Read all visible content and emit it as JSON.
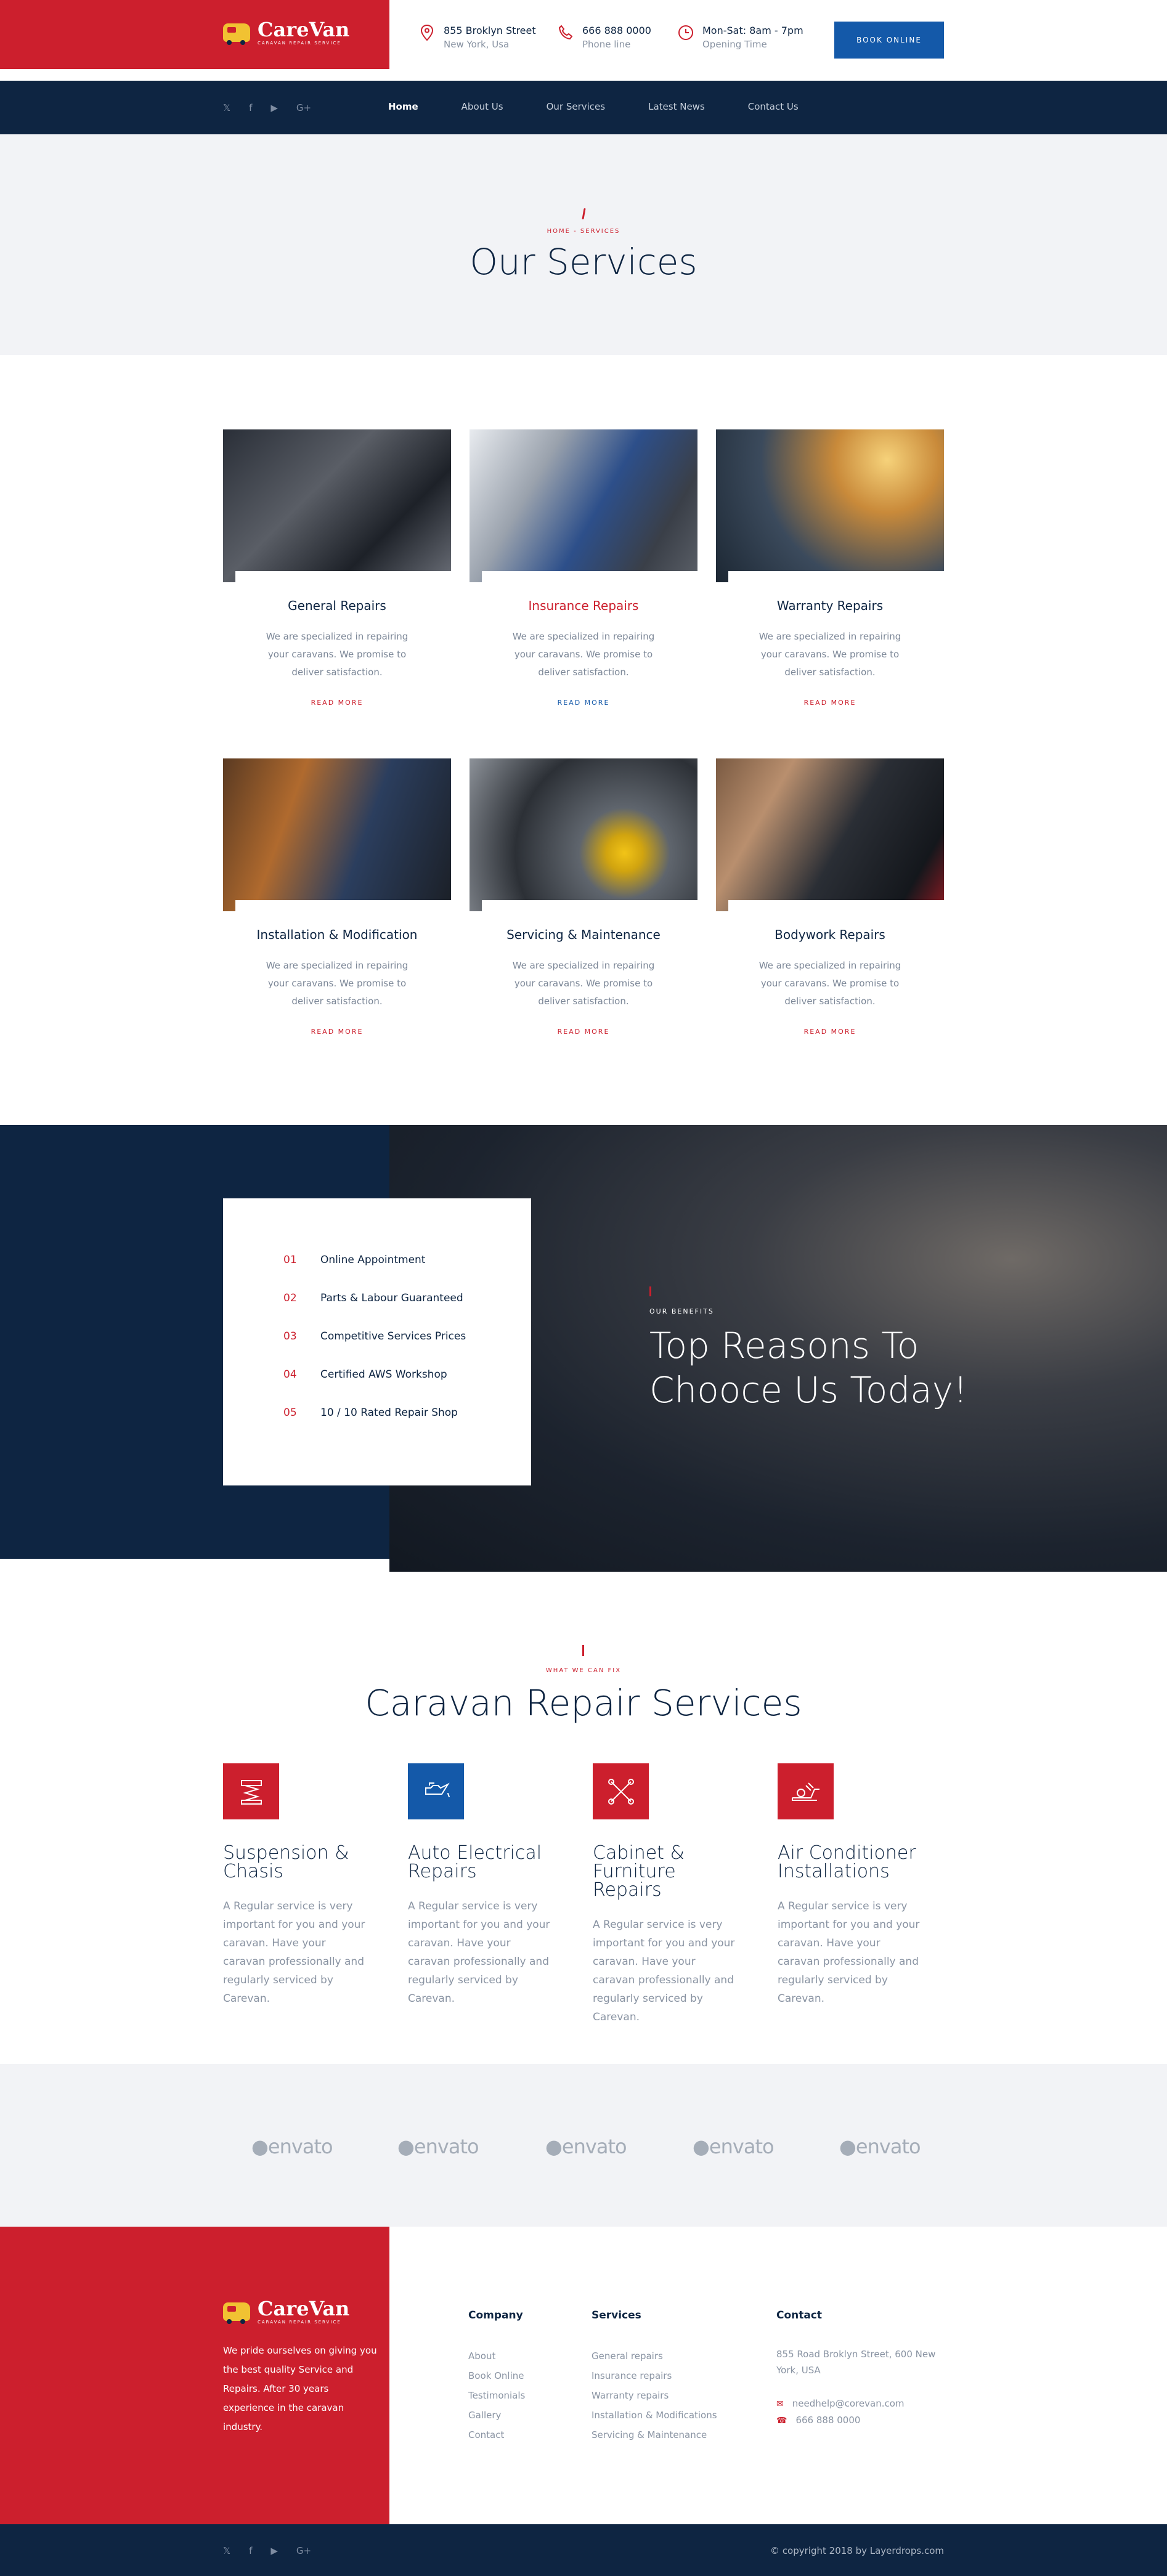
{
  "header": {
    "brand": "CareVan",
    "brand_tagline": "CARAVAN REPAIR SERVICE",
    "address": {
      "line1": "855 Broklyn Street",
      "line2": "New York, Usa"
    },
    "phone": {
      "line1": "666 888 0000",
      "line2": "Phone line"
    },
    "hours": {
      "line1": "Mon-Sat: 8am - 7pm",
      "line2": "Opening Time"
    },
    "book_button": "BOOK ONLINE"
  },
  "nav": {
    "social": [
      "twitter-icon",
      "facebook-icon",
      "youtube-icon",
      "google-plus-icon"
    ],
    "items": [
      {
        "label": "Home",
        "active": true
      },
      {
        "label": "About Us"
      },
      {
        "label": "Our Services"
      },
      {
        "label": "Latest News"
      },
      {
        "label": "Contact Us"
      }
    ]
  },
  "page_header": {
    "breadcrumb": "HOME  -  SERVICES",
    "title": "Our Services"
  },
  "services": [
    {
      "name": "General Repairs",
      "desc": "We are specialized in repairing your caravans. We promise to deliver satisfaction.",
      "more": "READ MORE"
    },
    {
      "name": "Insurance Repairs",
      "desc": "We are specialized in repairing your caravans. We promise to deliver satisfaction.",
      "more": "READ MORE"
    },
    {
      "name": "Warranty Repairs",
      "desc": "We are specialized in repairing your caravans. We promise to deliver satisfaction.",
      "more": "READ MORE"
    },
    {
      "name": "Installation & Modification",
      "desc": "We are specialized in repairing your caravans. We promise to deliver satisfaction.",
      "more": "READ MORE"
    },
    {
      "name": "Servicing & Maintenance",
      "desc": "We are specialized in repairing your caravans. We promise to deliver satisfaction.",
      "more": "READ MORE"
    },
    {
      "name": "Bodywork Repairs",
      "desc": "We are specialized in repairing your caravans. We promise to deliver satisfaction.",
      "more": "READ MORE"
    }
  ],
  "reasons": {
    "items": [
      {
        "num": "01",
        "label": "Online Appointment"
      },
      {
        "num": "02",
        "label": "Parts & Labour Guaranteed"
      },
      {
        "num": "03",
        "label": "Competitive Services Prices"
      },
      {
        "num": "04",
        "label": "Certified AWS Workshop"
      },
      {
        "num": "05",
        "label": "10 / 10 Rated Repair Shop"
      }
    ],
    "label": "OUR BENEFITS",
    "title": "Top Reasons To Chooce Us Today!"
  },
  "repair": {
    "label": "WHAT WE CAN FIX",
    "title": "Caravan Repair Services",
    "features": [
      {
        "title": "Suspension & Chasis",
        "desc": "A Regular service is very important for you and your caravan. Have your caravan professionally and regularly serviced by Carevan.",
        "icon": "suspension-icon",
        "color": "#cc1f2d"
      },
      {
        "title": "Auto Electrical Repairs",
        "desc": "A Regular service is very important for you and your caravan. Have your caravan professionally and regularly serviced by Carevan.",
        "icon": "oil-can-icon",
        "color": "#1459a9"
      },
      {
        "title": "Cabinet & Furniture Repairs",
        "desc": "A Regular service is very important for you and your caravan. Have your caravan professionally and regularly serviced by Carevan.",
        "icon": "wrench-cross-icon",
        "color": "#cc1f2d"
      },
      {
        "title": "Air Conditioner Installations",
        "desc": "A Regular service is very important for you and your caravan. Have your caravan professionally and regularly serviced by Carevan.",
        "icon": "air-conditioner-icon",
        "color": "#cc1f2d"
      }
    ]
  },
  "partners": [
    "envato",
    "envato",
    "envato",
    "envato",
    "envato"
  ],
  "footer": {
    "about": "We pride ourselves on giving you the best quality Service and Repairs. After 30 years experience in the caravan industry.",
    "company": {
      "heading": "Company",
      "items": [
        "About",
        "Book Online",
        "Testimonials",
        "Gallery",
        "Contact"
      ]
    },
    "services": {
      "heading": "Services",
      "items": [
        "General repairs",
        "Insurance repairs",
        "Warranty repairs",
        "Installation & Modifications",
        "Servicing & Maintenance"
      ]
    },
    "contact": {
      "heading": "Contact",
      "address": "855 Road Broklyn Street, 600 New York, USA",
      "email": "needhelp@corevan.com",
      "phone": "666 888 0000"
    },
    "copyright": "© copyright 2018 by Layerdrops.com"
  }
}
